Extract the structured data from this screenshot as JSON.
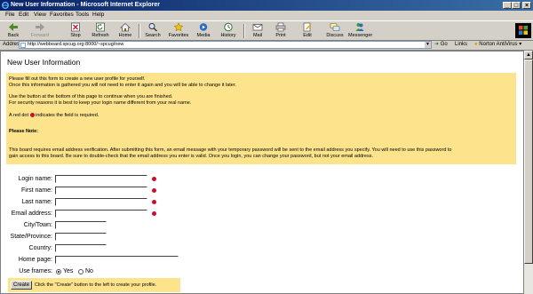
{
  "window": {
    "title": "New User Information - Microsoft Internet Explorer",
    "controls": [
      "_",
      "□",
      "×"
    ]
  },
  "menu": [
    "File",
    "Edit",
    "View",
    "Favorites",
    "Tools",
    "Help"
  ],
  "toolbar": {
    "back": "Back",
    "forward": "Forward",
    "stop": "Stop",
    "refresh": "Refresh",
    "home": "Home",
    "search": "Search",
    "favorites": "Favorites",
    "media": "Media",
    "history": "History",
    "mail": "Mail",
    "print": "Print",
    "edit": "Edit",
    "discuss": "Discuss",
    "messenger": "Messenger"
  },
  "address": {
    "label": "Address",
    "url": "http://webboard.spcug.org:8000/~spcug/new",
    "go": "Go",
    "links": "Links",
    "norton": "Norton AntiVirus"
  },
  "page": {
    "heading": "New User Information",
    "info": {
      "p1a": "Please fill out this form to create a new user profile for yourself.",
      "p1b": "Once this information is gathered you will not need to enter it again and you will be able to change it later.",
      "p2a": "Use the button at the bottom of this page to continue when you are finished.",
      "p2b": "For security reasons it is best to keep your login name different from your real name.",
      "req_prefix": "A red dot",
      "req_suffix": "indicates the field is required.",
      "note_label": "Please Note:",
      "note1": "This board requires email address verification. After submitting this form, an email message with your temporary password will be sent to the email address you specify. You will need to use this password to",
      "note2": "gain access to this board. Be sure to double-check that the email address you enter is valid. Once you login, you can change your password, but not your email address."
    },
    "fields": {
      "login": {
        "label": "Login name:",
        "value": ""
      },
      "first": {
        "label": "First name:",
        "value": ""
      },
      "last": {
        "label": "Last name:",
        "value": ""
      },
      "email": {
        "label": "Email address:",
        "value": ""
      },
      "city": {
        "label": "City/Town:",
        "value": ""
      },
      "state": {
        "label": "State/Province:",
        "value": ""
      },
      "country": {
        "label": "Country:",
        "value": ""
      },
      "homepage": {
        "label": "Home page:",
        "value": ""
      }
    },
    "frames": {
      "label": "Use frames:",
      "yes": "Yes",
      "no": "No",
      "selected": "Yes"
    },
    "create": {
      "button": "Create",
      "hint": "Click the \"Create\" button to the left to create your profile."
    }
  }
}
